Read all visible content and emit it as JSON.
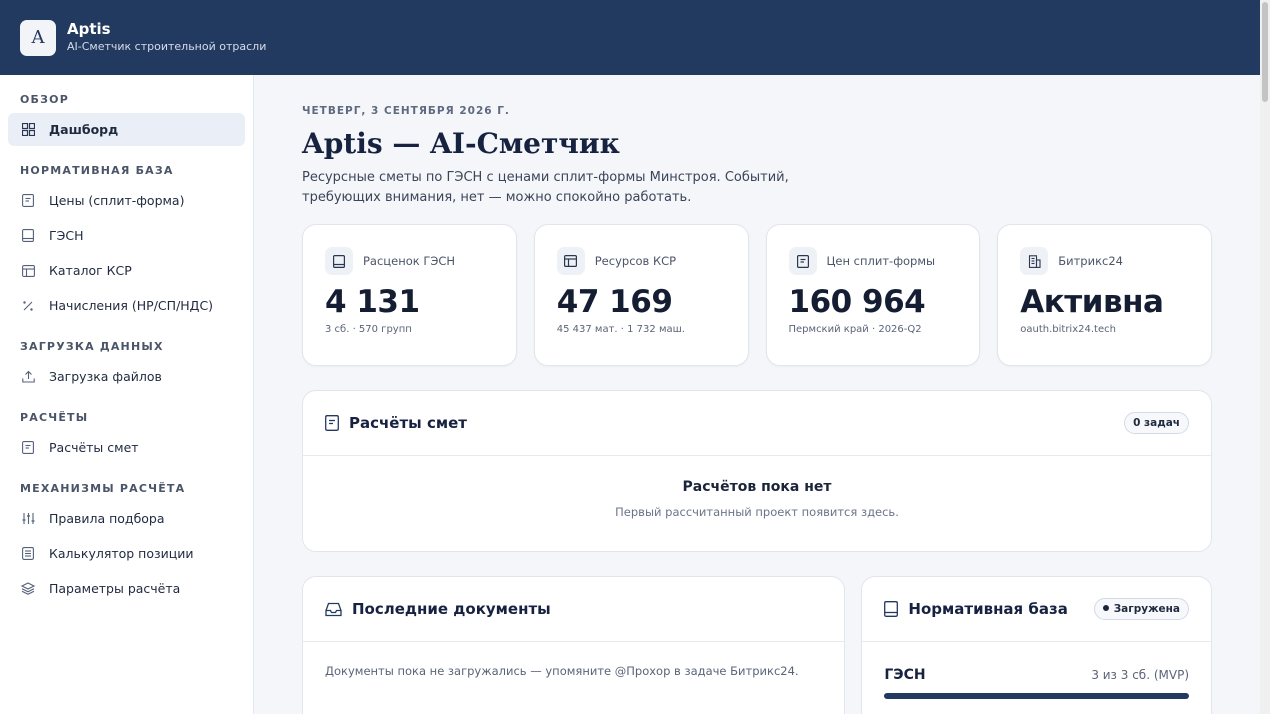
{
  "header": {
    "logo_letter": "A",
    "app_name": "Aptis",
    "subtitle": "AI-Сметчик строительной отрасли"
  },
  "sidebar": {
    "sections": [
      {
        "title": "ОБЗОР",
        "items": [
          {
            "label": "Дашборд",
            "icon": "grid-icon",
            "active": true
          }
        ]
      },
      {
        "title": "НОРМАТИВНАЯ БАЗА",
        "items": [
          {
            "label": "Цены (сплит-форма)",
            "icon": "document-icon"
          },
          {
            "label": "ГЭСН",
            "icon": "book-icon"
          },
          {
            "label": "Каталог КСР",
            "icon": "table-icon"
          },
          {
            "label": "Начисления (НР/СП/НДС)",
            "icon": "percent-icon"
          }
        ]
      },
      {
        "title": "ЗАГРУЗКА ДАННЫХ",
        "items": [
          {
            "label": "Загрузка файлов",
            "icon": "upload-icon"
          }
        ]
      },
      {
        "title": "РАСЧЁТЫ",
        "items": [
          {
            "label": "Расчёты смет",
            "icon": "document-icon"
          }
        ]
      },
      {
        "title": "МЕХАНИЗМЫ РАСЧЁТА",
        "items": [
          {
            "label": "Правила подбора",
            "icon": "sliders-icon"
          },
          {
            "label": "Калькулятор позиции",
            "icon": "calculator-icon"
          },
          {
            "label": "Параметры расчёта",
            "icon": "layers-icon"
          }
        ]
      }
    ]
  },
  "main": {
    "date": "ЧЕТВЕРГ, 3 СЕНТЯБРЯ 2026 Г.",
    "title": "Aptis — AI-Сметчик",
    "description": "Ресурсные сметы по ГЭСН с ценами сплит-формы Минстроя. Событий, требующих внимания, нет — можно спокойно работать.",
    "stats": [
      {
        "label": "Расценок ГЭСН",
        "value": "4 131",
        "sub": "3 сб. · 570 групп",
        "icon": "book-icon"
      },
      {
        "label": "Ресурсов КСР",
        "value": "47 169",
        "sub": "45 437 мат. · 1 732 маш.",
        "icon": "table-icon"
      },
      {
        "label": "Цен сплит-формы",
        "value": "160 964",
        "sub": "Пермский край · 2026-Q2",
        "icon": "document-icon"
      },
      {
        "label": "Битрикс24",
        "value": "Активна",
        "sub": "oauth.bitrix24.tech",
        "icon": "building-icon"
      }
    ],
    "calc": {
      "title": "Расчёты смет",
      "badge": "0 задач",
      "empty_title": "Расчётов пока нет",
      "empty_sub": "Первый рассчитанный проект появится здесь."
    },
    "docs": {
      "title": "Последние документы",
      "empty": "Документы пока не загружались — упомяните @Прохор в задаче Битрикс24."
    },
    "norm": {
      "title": "Нормативная база",
      "badge": "Загружена",
      "row_name": "ГЭСН",
      "row_meta": "3 из 3 сб. (MVP)",
      "progress": 1.0
    }
  },
  "colors": {
    "primary": "#233a60",
    "background": "#f4f6f9",
    "card": "#ffffff"
  }
}
